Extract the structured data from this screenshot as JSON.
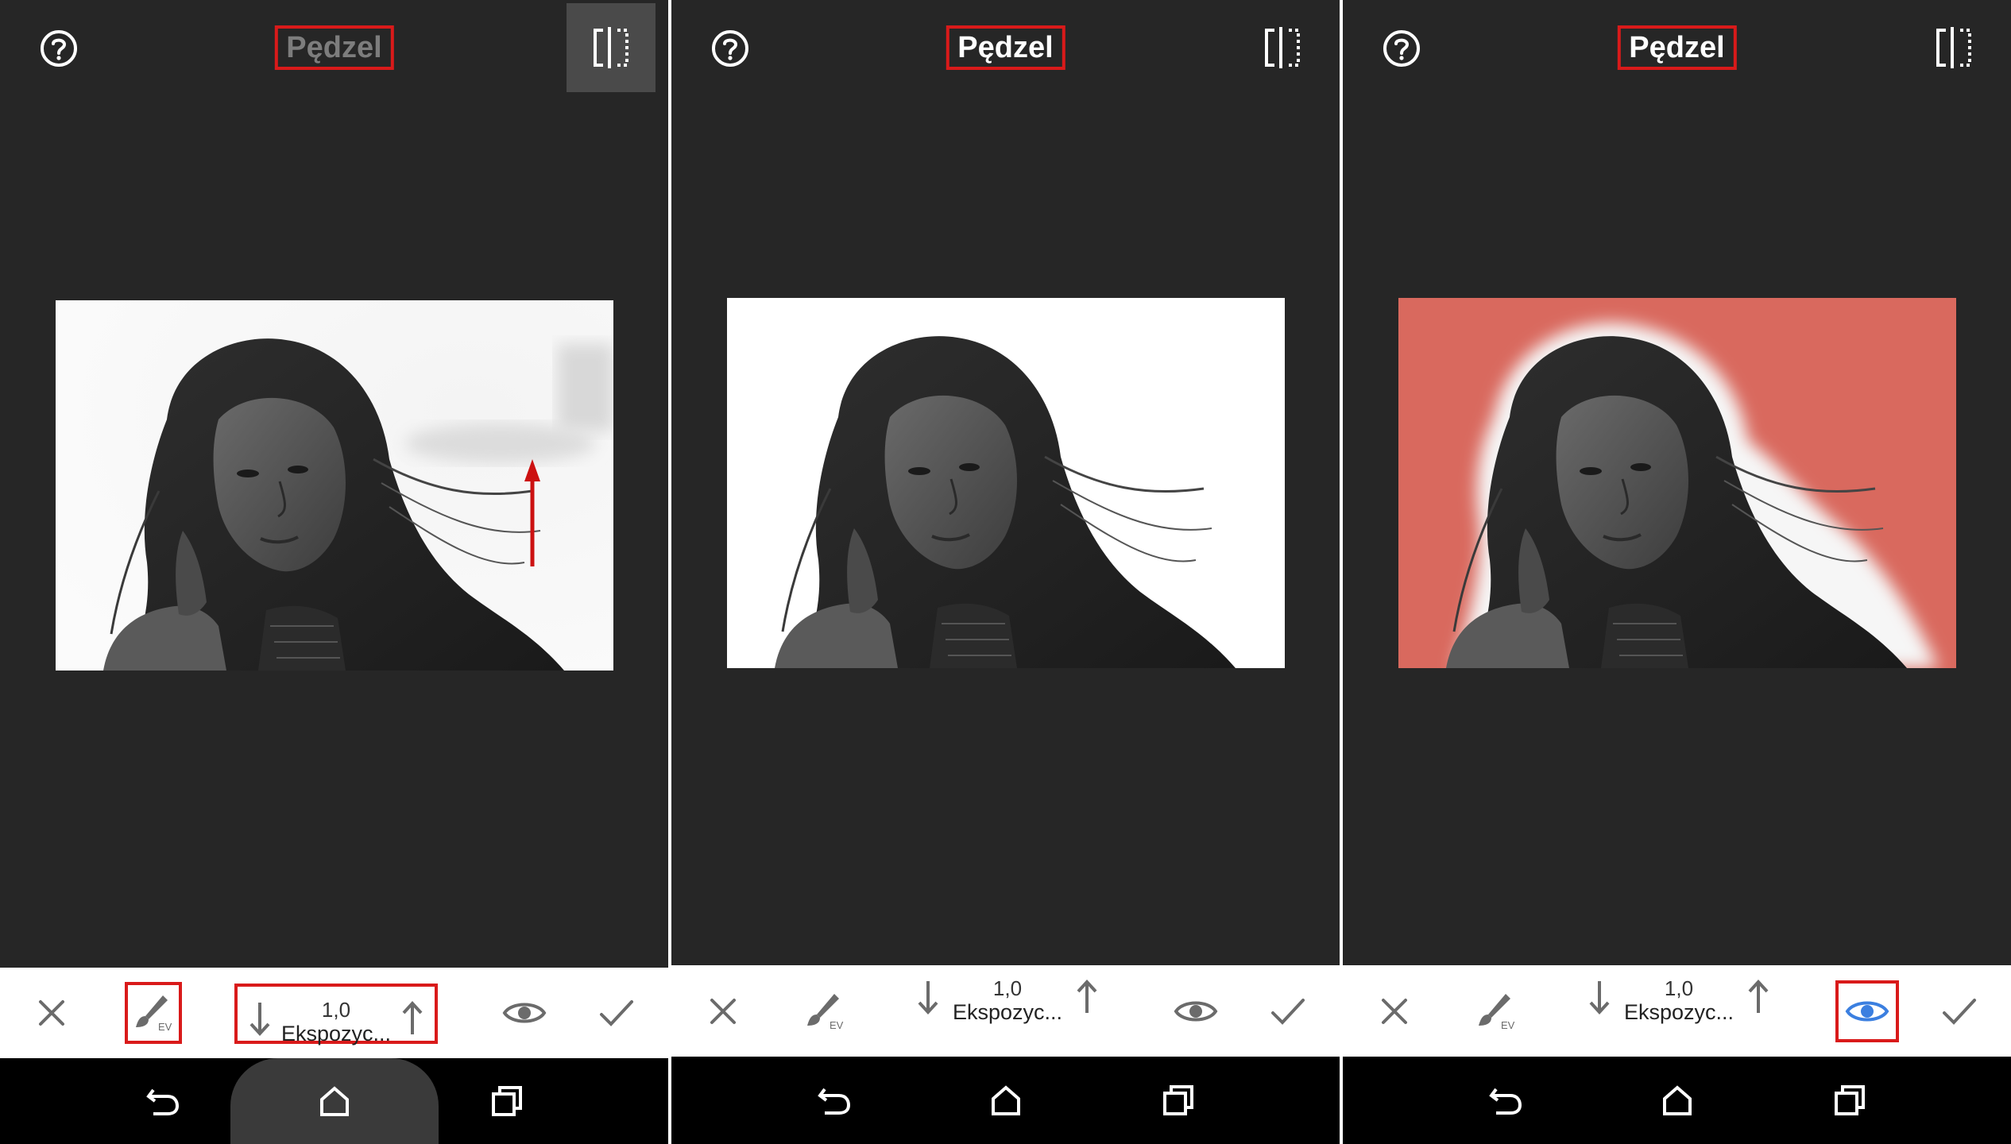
{
  "screens": [
    {
      "title": "Pędzel",
      "stepper": {
        "value": "1,0",
        "label": "Ekspozyc..."
      },
      "brush_badge": "EV",
      "annotation": "red-arrow-up",
      "overlay": "none"
    },
    {
      "title": "Pędzel",
      "stepper": {
        "value": "1,0",
        "label": "Ekspozyc..."
      },
      "brush_badge": "EV",
      "overlay": "none"
    },
    {
      "title": "Pędzel",
      "stepper": {
        "value": "1,0",
        "label": "Ekspozyc..."
      },
      "brush_badge": "EV",
      "overlay": "mask-red",
      "eye_active": true
    }
  ],
  "colors": {
    "background": "#262626",
    "toolbar": "#ffffff",
    "navbar": "#000000",
    "highlight_box": "#d91a1a",
    "mask_overlay": "#d9695e",
    "active_eye": "#3b7fe0"
  },
  "icons": [
    "help-icon",
    "compare-icon",
    "close-icon",
    "brush-icon",
    "arrow-down-icon",
    "arrow-up-icon",
    "eye-icon",
    "check-icon",
    "back-icon",
    "home-icon",
    "recent-apps-icon"
  ]
}
